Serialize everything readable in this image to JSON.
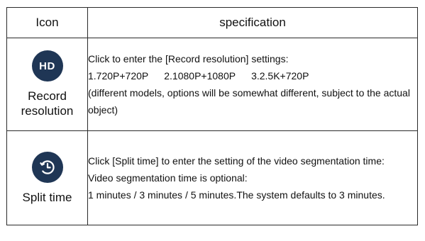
{
  "header": {
    "col_icon": "Icon",
    "col_spec": "specification"
  },
  "rows": [
    {
      "icon_name": "hd-icon",
      "icon_text": "HD",
      "label": "Record resolution",
      "lines": [
        "Click to enter the [Record resolution] settings:",
        "1.720P+720P",
        "2.1080P+1080P",
        "3.2.5K+720P",
        "(different models, options will be somewhat different, subject to the actual object)"
      ]
    },
    {
      "icon_name": "timer-icon",
      "label": "Split time",
      "lines": [
        "Click [Split time] to enter the setting of the video segmentation time:",
        "Video segmentation time is optional:",
        "1 minutes / 3 minutes / 5 minutes.The system defaults to 3 minutes."
      ]
    }
  ],
  "colors": {
    "icon_bg": "#1f3655",
    "border": "#2a2a2a"
  }
}
